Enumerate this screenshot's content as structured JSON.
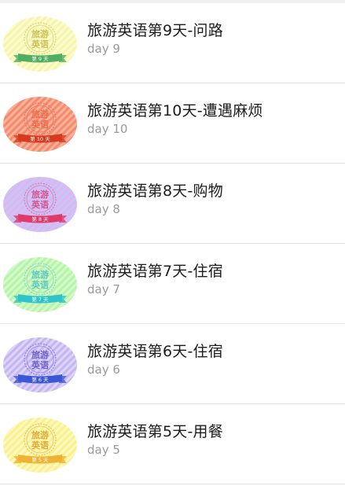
{
  "lessons": [
    {
      "title": "旅游英语第9天-问路",
      "subtitle": "day 9",
      "thumb": {
        "line1": "旅游",
        "line2": "英语",
        "ribbon": "第 9 天",
        "bg": "#f6f5a8",
        "stripe": "#fbfbd4",
        "ring": "#d8d37a",
        "text": "#c9c25a",
        "ribbon_color": "#4fae62"
      }
    },
    {
      "title": "旅游英语第10天-遭遇麻烦",
      "subtitle": "day 10",
      "thumb": {
        "line1": "旅游",
        "line2": "英语",
        "ribbon": "第 10 天",
        "bg": "#f58a6c",
        "stripe": "#f9b29c",
        "ring": "#e8795a",
        "text": "#e8704f",
        "ribbon_color": "#d63a1f"
      }
    },
    {
      "title": "旅游英语第8天-购物",
      "subtitle": "day 8",
      "thumb": {
        "line1": "旅游",
        "line2": "英语",
        "ribbon": "第 8 天",
        "bg": "#e3b3f0",
        "stripe": "#c2c8f7",
        "ring": "#d17fb8",
        "text": "#d2568e",
        "ribbon_color": "#e03a6a"
      }
    },
    {
      "title": "旅游英语第7天-住宿",
      "subtitle": "day 7",
      "thumb": {
        "line1": "旅游",
        "line2": "英语",
        "ribbon": "第 7 天",
        "bg": "#b5f5a8",
        "stripe": "#d6f9cc",
        "ring": "#8fd6c9",
        "text": "#5ec7c0",
        "ribbon_color": "#2ec4c9"
      }
    },
    {
      "title": "旅游英语第6天-住宿",
      "subtitle": "day 6",
      "thumb": {
        "line1": "旅游",
        "line2": "英语",
        "ribbon": "第 6 天",
        "bg": "#c4b6f3",
        "stripe": "#ddd4f8",
        "ring": "#8f84d8",
        "text": "#6f62c8",
        "ribbon_color": "#3c57d6"
      }
    },
    {
      "title": "旅游英语第5天-用餐",
      "subtitle": "day 5",
      "thumb": {
        "line1": "旅游",
        "line2": "英语",
        "ribbon": "第 5 天",
        "bg": "#f9f28a",
        "stripe": "#fcf8c4",
        "ring": "#e8c060",
        "text": "#e0aa3a",
        "ribbon_color": "#f0b234"
      }
    }
  ]
}
